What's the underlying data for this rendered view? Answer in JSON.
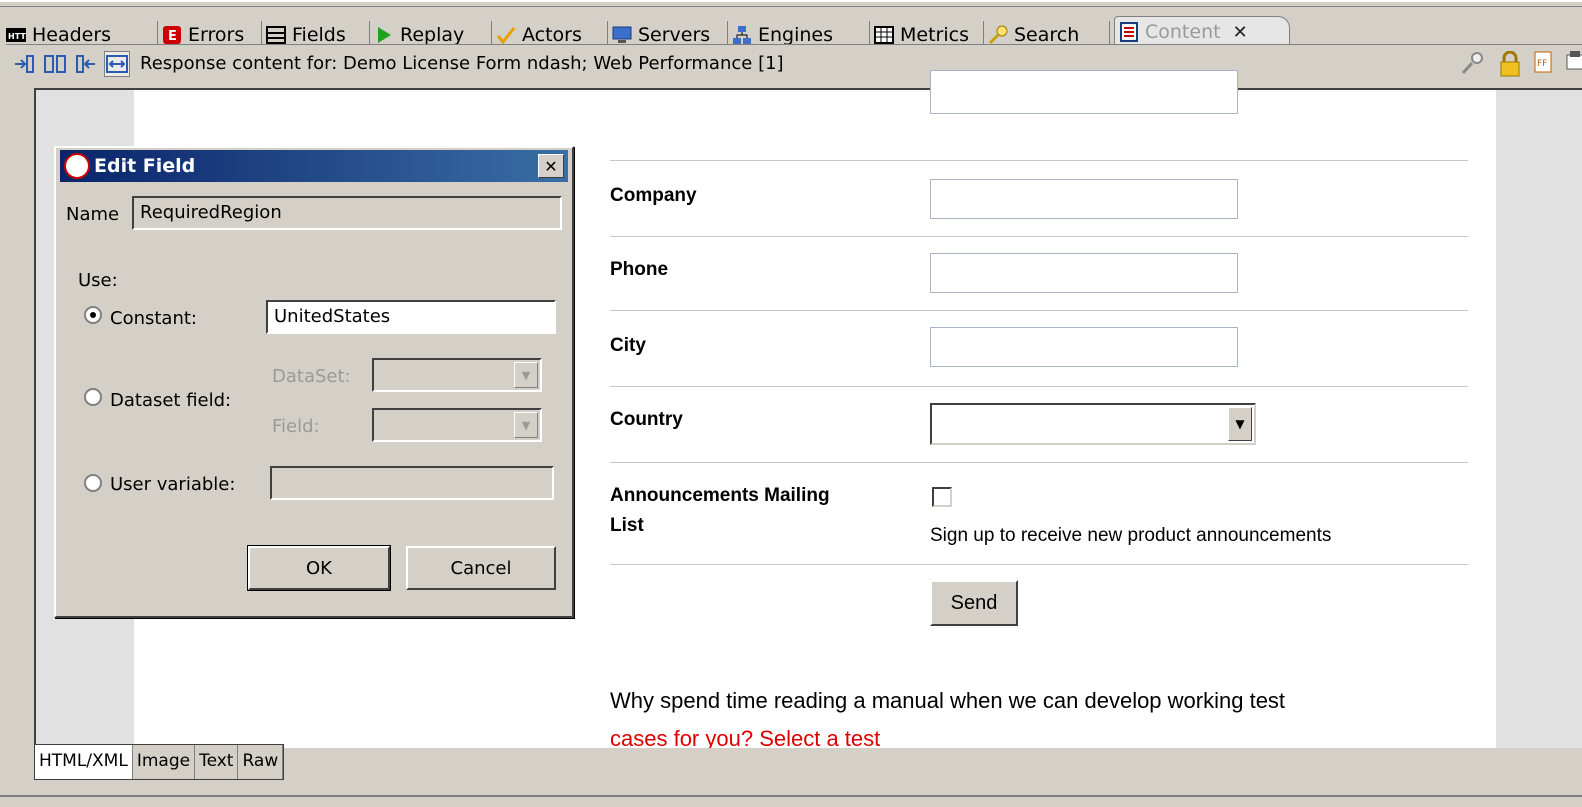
{
  "tabs": [
    {
      "label": "Headers",
      "icon": "http-icon"
    },
    {
      "label": "Errors",
      "icon": "error-icon"
    },
    {
      "label": "Fields",
      "icon": "fields-icon"
    },
    {
      "label": "Replay",
      "icon": "play-icon"
    },
    {
      "label": "Actors",
      "icon": "check-icon"
    },
    {
      "label": "Servers",
      "icon": "monitor-icon"
    },
    {
      "label": "Engines",
      "icon": "network-icon"
    },
    {
      "label": "Metrics",
      "icon": "grid-icon"
    },
    {
      "label": "Search",
      "icon": "search-icon"
    },
    {
      "label": "Content",
      "icon": "document-icon",
      "active": true
    }
  ],
  "toolbar": {
    "response_text": "Response content for: Demo License Form ndash; Web Performance [1]"
  },
  "form": {
    "company_label": "Company",
    "phone_label": "Phone",
    "city_label": "City",
    "country_label": "Country",
    "mailing_label_line1": "Announcements Mailing",
    "mailing_label_line2": "List",
    "mailing_hint": "Sign up to receive new product announcements",
    "send_label": "Send",
    "paragraph": "Why spend time reading a manual when we can develop working test",
    "paragraph_cut": "cases for you? Select a test"
  },
  "dialog": {
    "title": "Edit Field",
    "name_label": "Name",
    "name_value": "RequiredRegion",
    "use_label": "Use:",
    "constant_label": "Constant:",
    "constant_value": "UnitedStates",
    "dataset_field_label": "Dataset field:",
    "dataset_label": "DataSet:",
    "field_label": "Field:",
    "user_variable_label": "User variable:",
    "ok_label": "OK",
    "cancel_label": "Cancel"
  },
  "bottom_tabs": [
    "HTML/XML",
    "Image",
    "Text",
    "Raw"
  ],
  "colors": {
    "title_bar": "#0a246a",
    "error_red": "#cc0000",
    "play_green": "#22a020",
    "check_orange": "#e8a000"
  }
}
